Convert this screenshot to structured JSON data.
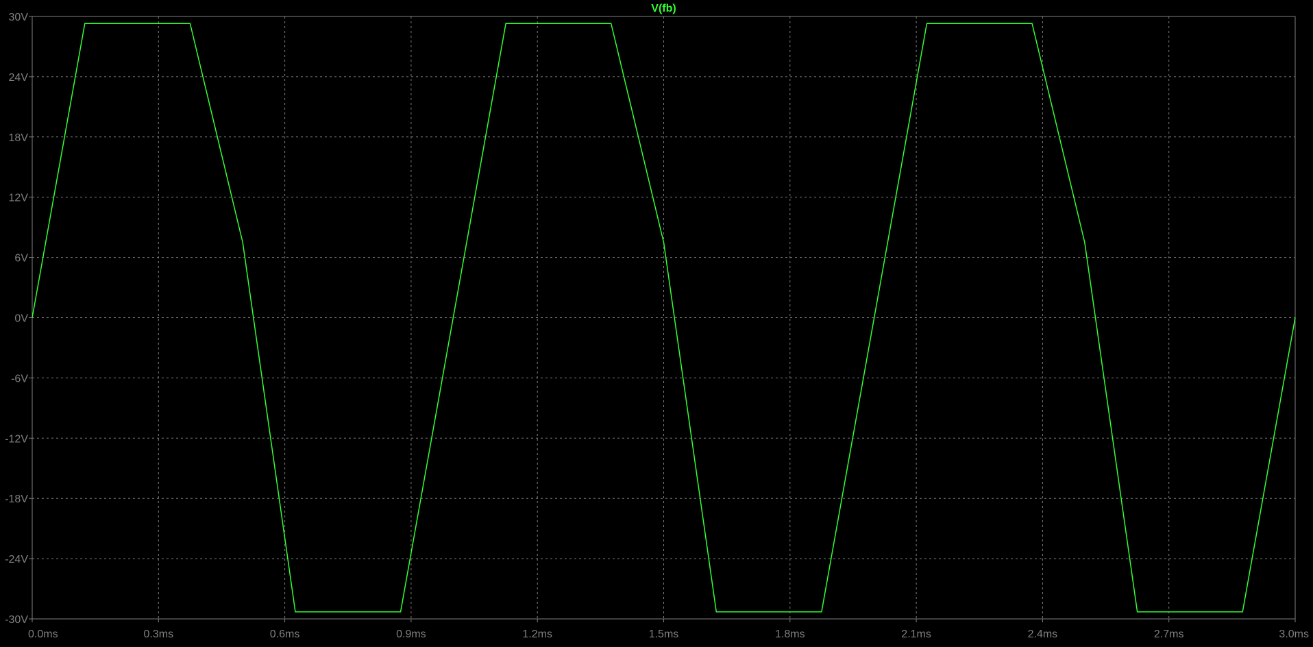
{
  "colors": {
    "background": "#000000",
    "frame": "#808080",
    "grid": "#808080",
    "tick_text": "#808080",
    "trace": "#32ff32",
    "trace_title": "#32ff32"
  },
  "chart_data": {
    "type": "line",
    "title": "V(fb)",
    "xlabel": "",
    "ylabel": "",
    "x_unit": "ms",
    "y_unit": "V",
    "xlim": [
      0,
      3.0
    ],
    "ylim": [
      -30,
      30
    ],
    "grid": true,
    "x_ticks": [
      "0.0ms",
      "0.3ms",
      "0.6ms",
      "0.9ms",
      "1.2ms",
      "1.5ms",
      "1.8ms",
      "2.1ms",
      "2.4ms",
      "2.7ms",
      "3.0ms"
    ],
    "y_ticks": [
      "30V",
      "24V",
      "18V",
      "12V",
      "6V",
      "0V",
      "-6V",
      "-12V",
      "-18V",
      "-24V",
      "-30V"
    ],
    "series": [
      {
        "name": "V(fb)",
        "x": [
          0.0,
          0.125,
          0.375,
          0.5,
          0.625,
          0.875,
          1.0,
          1.125,
          1.375,
          1.5,
          1.625,
          1.875,
          2.0,
          2.125,
          2.375,
          2.5,
          2.625,
          2.875,
          3.0
        ],
        "y": [
          0,
          29.3,
          29.3,
          7.5,
          -29.3,
          -29.3,
          0,
          29.3,
          29.3,
          7.5,
          -29.3,
          -29.3,
          0,
          29.3,
          29.3,
          7.5,
          -29.3,
          -29.3,
          0
        ]
      }
    ]
  }
}
